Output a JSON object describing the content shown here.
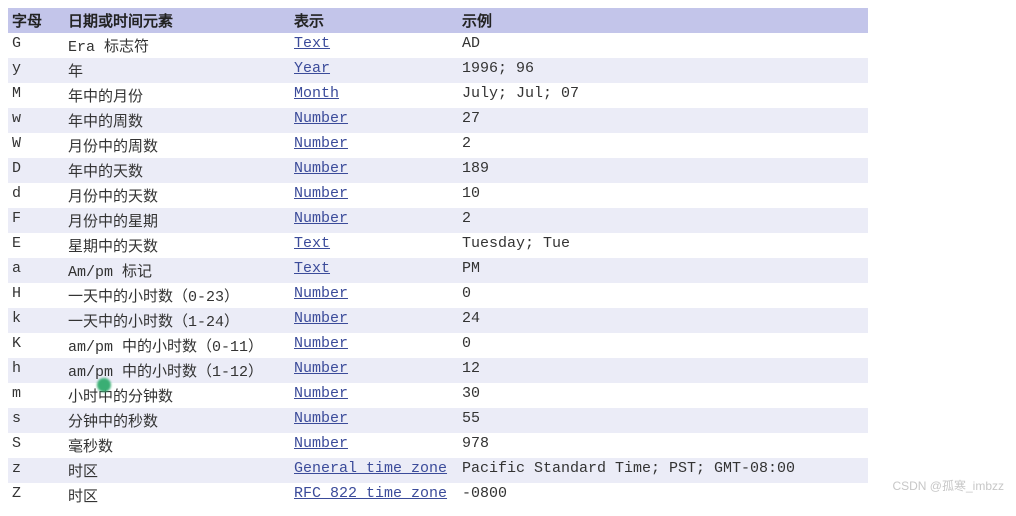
{
  "headers": {
    "letter": "字母",
    "component": "日期或时间元素",
    "presentation": "表示",
    "examples": "示例"
  },
  "rows": [
    {
      "letter": "G",
      "component": "Era 标志符",
      "presentation": "Text",
      "example": "AD"
    },
    {
      "letter": "y",
      "component": "年",
      "presentation": "Year",
      "example": "1996; 96"
    },
    {
      "letter": "M",
      "component": "年中的月份",
      "presentation": "Month",
      "example": "July; Jul; 07"
    },
    {
      "letter": "w",
      "component": "年中的周数",
      "presentation": "Number",
      "example": "27"
    },
    {
      "letter": "W",
      "component": "月份中的周数",
      "presentation": "Number",
      "example": "2"
    },
    {
      "letter": "D",
      "component": "年中的天数",
      "presentation": "Number",
      "example": "189"
    },
    {
      "letter": "d",
      "component": "月份中的天数",
      "presentation": "Number",
      "example": "10"
    },
    {
      "letter": "F",
      "component": "月份中的星期",
      "presentation": "Number",
      "example": "2"
    },
    {
      "letter": "E",
      "component": "星期中的天数",
      "presentation": "Text",
      "example": "Tuesday; Tue"
    },
    {
      "letter": "a",
      "component": "Am/pm 标记",
      "presentation": "Text",
      "example": "PM"
    },
    {
      "letter": "H",
      "component": "一天中的小时数（0-23）",
      "presentation": "Number",
      "example": "0"
    },
    {
      "letter": "k",
      "component": "一天中的小时数（1-24）",
      "presentation": "Number",
      "example": "24"
    },
    {
      "letter": "K",
      "component": "am/pm 中的小时数（0-11）",
      "presentation": "Number",
      "example": "0"
    },
    {
      "letter": "h",
      "component": "am/pm 中的小时数（1-12）",
      "presentation": "Number",
      "example": "12"
    },
    {
      "letter": "m",
      "component": "小时中的分钟数",
      "presentation": "Number",
      "example": "30"
    },
    {
      "letter": "s",
      "component": "分钟中的秒数",
      "presentation": "Number",
      "example": "55"
    },
    {
      "letter": "S",
      "component": "毫秒数",
      "presentation": "Number",
      "example": "978"
    },
    {
      "letter": "z",
      "component": "时区",
      "presentation": "General time zone",
      "example": "Pacific Standard Time; PST; GMT-08:00"
    },
    {
      "letter": "Z",
      "component": "时区",
      "presentation": "RFC 822 time zone",
      "example": "-0800"
    }
  ],
  "watermark": "CSDN @孤寒_imbzz"
}
